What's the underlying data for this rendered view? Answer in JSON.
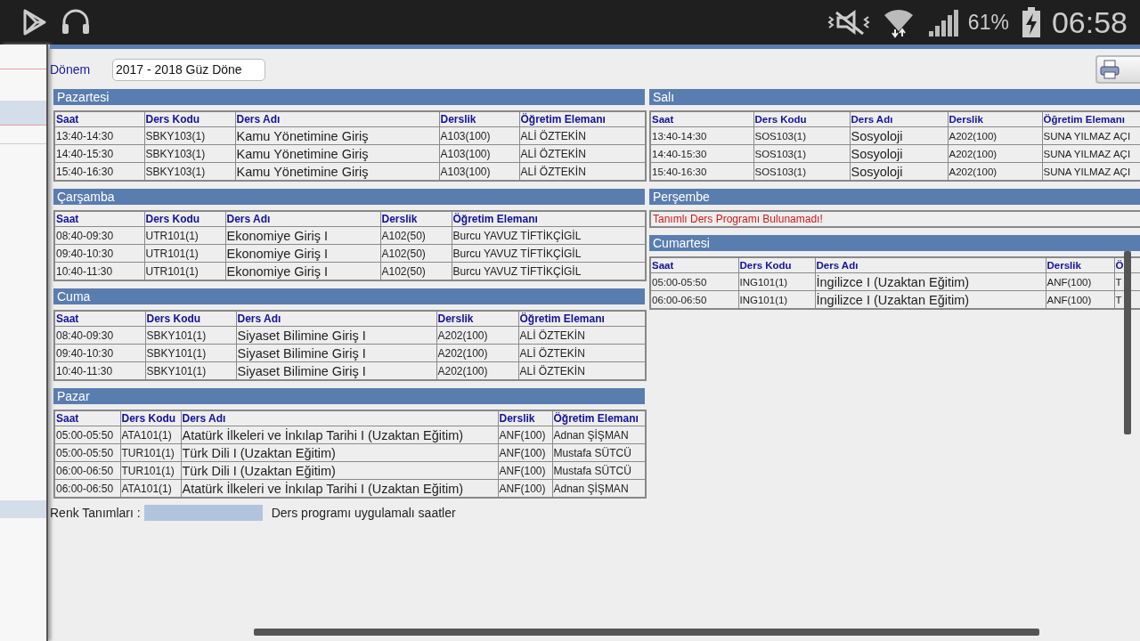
{
  "status_bar": {
    "battery": "61%",
    "time": "06:58"
  },
  "period": {
    "label": "Dönem",
    "value": "2017 - 2018 Güz Döne"
  },
  "left_column": [
    {
      "name": "Pazartesi",
      "columns": [
        "Saat",
        "Ders Kodu",
        "Ders Adı",
        "Derslik",
        "Öğretim Elemanı"
      ],
      "rows": [
        [
          "13:40-14:30",
          "SBKY103(1)",
          "Kamu Yönetimine Giriş",
          "A103(100)",
          "ALİ ÖZTEKİN"
        ],
        [
          "14:40-15:30",
          "SBKY103(1)",
          "Kamu Yönetimine Giriş",
          "A103(100)",
          "ALİ ÖZTEKİN"
        ],
        [
          "15:40-16:30",
          "SBKY103(1)",
          "Kamu Yönetimine Giriş",
          "A103(100)",
          "ALİ ÖZTEKİN"
        ]
      ]
    },
    {
      "name": "Çarşamba",
      "columns": [
        "Saat",
        "Ders Kodu",
        "Ders Adı",
        "Derslik",
        "Öğretim Elemanı"
      ],
      "rows": [
        [
          "08:40-09:30",
          "UTR101(1)",
          "Ekonomiye Giriş I",
          "A102(50)",
          "Burcu YAVUZ TİFTİKÇİGİL"
        ],
        [
          "09:40-10:30",
          "UTR101(1)",
          "Ekonomiye Giriş I",
          "A102(50)",
          "Burcu YAVUZ TİFTİKÇİGİL"
        ],
        [
          "10:40-11:30",
          "UTR101(1)",
          "Ekonomiye Giriş I",
          "A102(50)",
          "Burcu YAVUZ TİFTİKÇİGİL"
        ]
      ]
    },
    {
      "name": "Cuma",
      "columns": [
        "Saat",
        "Ders Kodu",
        "Ders Adı",
        "Derslik",
        "Öğretim Elemanı"
      ],
      "rows": [
        [
          "08:40-09:30",
          "SBKY101(1)",
          "Siyaset Bilimine Giriş I",
          "A202(100)",
          "ALİ ÖZTEKİN"
        ],
        [
          "09:40-10:30",
          "SBKY101(1)",
          "Siyaset Bilimine Giriş I",
          "A202(100)",
          "ALİ ÖZTEKİN"
        ],
        [
          "10:40-11:30",
          "SBKY101(1)",
          "Siyaset Bilimine Giriş I",
          "A202(100)",
          "ALİ ÖZTEKİN"
        ]
      ]
    },
    {
      "name": "Pazar",
      "columns": [
        "Saat",
        "Ders Kodu",
        "Ders Adı",
        "Derslik",
        "Öğretim Elemanı"
      ],
      "rows": [
        [
          "05:00-05:50",
          "ATA101(1)",
          "Atatürk İlkeleri ve İnkılap Tarihi I (Uzaktan Eğitim)",
          "ANF(100)",
          "Adnan ŞİŞMAN"
        ],
        [
          "05:00-05:50",
          "TUR101(1)",
          "Türk Dili I (Uzaktan Eğitim)",
          "ANF(100)",
          "Mustafa SÜTCÜ"
        ],
        [
          "06:00-06:50",
          "TUR101(1)",
          "Türk Dili I (Uzaktan Eğitim)",
          "ANF(100)",
          "Mustafa SÜTCÜ"
        ],
        [
          "06:00-06:50",
          "ATA101(1)",
          "Atatürk İlkeleri ve İnkılap Tarihi I (Uzaktan Eğitim)",
          "ANF(100)",
          "Adnan ŞİŞMAN"
        ]
      ]
    }
  ],
  "right_column": [
    {
      "name": "Salı",
      "columns": [
        "Saat",
        "Ders Kodu",
        "Ders Adı",
        "Derslik",
        "Öğretim Elemanı"
      ],
      "rows": [
        [
          "13:40-14:30",
          "SOS103(1)",
          "Sosyoloji",
          "A202(100)",
          "SUNA YILMAZ AÇI"
        ],
        [
          "14:40-15:30",
          "SOS103(1)",
          "Sosyoloji",
          "A202(100)",
          "SUNA YILMAZ AÇI"
        ],
        [
          "15:40-16:30",
          "SOS103(1)",
          "Sosyoloji",
          "A202(100)",
          "SUNA YILMAZ AÇI"
        ]
      ]
    },
    {
      "name": "Perşembe",
      "message": "Tanımlı Ders Programı Bulunamadı!"
    },
    {
      "name": "Cumartesi",
      "columns": [
        "Saat",
        "Ders Kodu",
        "Ders Adı",
        "Derslik",
        "Ö"
      ],
      "rows": [
        [
          "05:00-05:50",
          "ING101(1)",
          "İngilizce I (Uzaktan Eğitim)",
          "ANF(100)",
          "T"
        ],
        [
          "06:00-06:50",
          "ING101(1)",
          "İngilizce I (Uzaktan Eğitim)",
          "ANF(100)",
          "T"
        ]
      ]
    }
  ],
  "legend": {
    "label": "Renk Tanımları :",
    "text": "Ders programı uygulamalı saatler"
  }
}
